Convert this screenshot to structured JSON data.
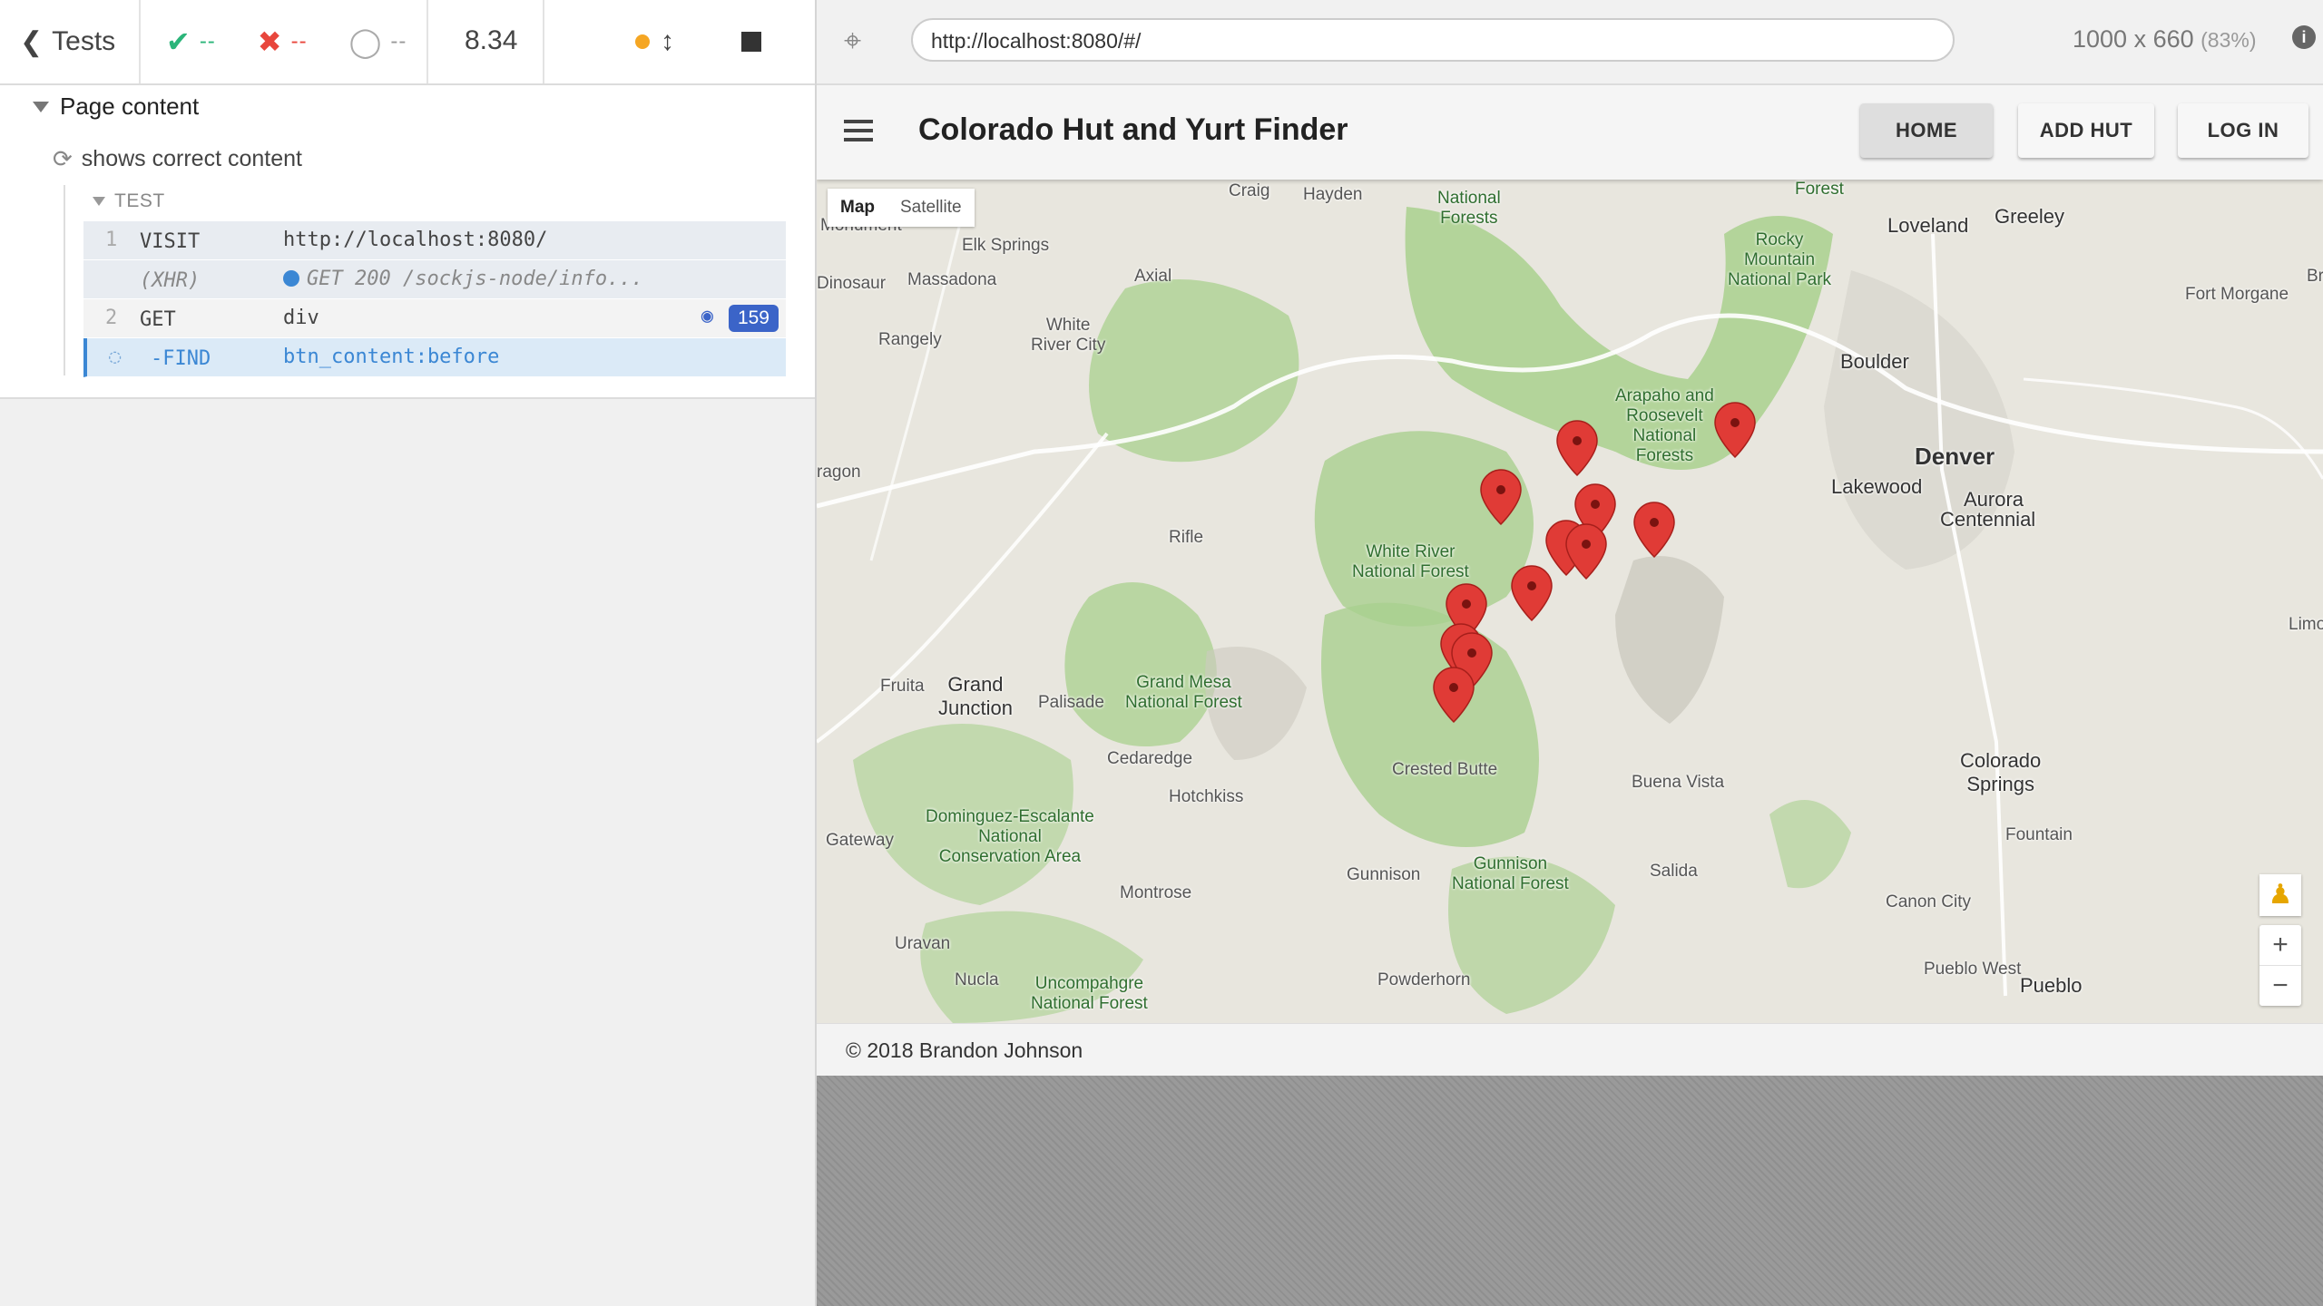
{
  "reporter": {
    "back_label": "Tests",
    "passed": "--",
    "failed": "--",
    "pending": "--",
    "duration": "8.34",
    "suite_title": "Page content",
    "test_title": "shows correct content",
    "test_section": "TEST",
    "commands": [
      {
        "num": "1",
        "name": "VISIT",
        "message": "http://localhost:8080/"
      },
      {
        "num": "",
        "name": "(XHR)",
        "message": "GET 200 /sockjs-node/info..."
      },
      {
        "num": "2",
        "name": "GET",
        "message": "div",
        "count": "159"
      },
      {
        "num": "",
        "name": "-FIND",
        "message": "btn_content:before"
      }
    ]
  },
  "aut": {
    "url": "http://localhost:8080/#/",
    "viewport": "1000 x 660",
    "scale": "(83%)"
  },
  "app": {
    "title": "Colorado Hut and Yurt Finder",
    "nav": [
      "HOME",
      "ADD HUT",
      "LOG IN"
    ],
    "map_types": [
      "Map",
      "Satellite"
    ],
    "footer": "© 2018 Brandon Johnson",
    "map_labels": {
      "monument": "Monument",
      "elk_springs": "Elk Springs",
      "dinosaur": "Dinosaur",
      "massadona": "Massadona",
      "rangely": "Rangely",
      "white_river_city": "White\nRiver City",
      "axial": "Axial",
      "craig": "Craig",
      "hayden": "Hayden",
      "loveland": "Loveland",
      "greeley": "Greeley",
      "fort_morgan": "Fort Morgane",
      "boulder": "Boulder",
      "denver": "Denver",
      "lakewood": "Lakewood",
      "aurora": "Aurora",
      "centennial": "Centennial",
      "grand_junction": "Grand\nJunction",
      "fruita": "Fruita",
      "palisade": "Palisade",
      "cedaredge": "Cedaredge",
      "hotchkiss": "Hotchkiss",
      "montrose": "Montrose",
      "gunnison": "Gunnison",
      "crested_butte": "Crested Butte",
      "buena_vista": "Buena Vista",
      "salida": "Salida",
      "canon_city": "Canon City",
      "colorado_springs": "Colorado\nSprings",
      "fountain": "Fountain",
      "pueblo_west": "Pueblo West",
      "pueblo": "Pueblo",
      "uravan": "Uravan",
      "nucla": "Nucla",
      "powderhorn": "Powderhorn",
      "limo": "Limo",
      "rifle": "Rifle",
      "gateway": "Gateway",
      "ragon": "ragon",
      "br": "Br",
      "rocky_mountain_np": "Rocky\nMountain\nNational Park",
      "national_forests_top": "National\nForests",
      "arapaho": "Arapaho and\nRoosevelt\nNational\nForests",
      "white_river_nf": "White River\nNational Forest",
      "grand_mesa_nf": "Grand Mesa\nNational Forest",
      "gunnison_nf": "Gunnison\nNational Forest",
      "dominguez": "Dominguez-Escalante\nNational\nConservation Area",
      "uncompahgre": "Uncompahgre\nNational Forest",
      "forest_top": "Forest"
    }
  },
  "colors": {
    "accent": "#3b87d4",
    "badge": "#3b64c8",
    "pass": "#2bb57a",
    "fail": "#e8463c",
    "marker": "#e03b36",
    "forest": "#a9d08e",
    "land": "#e8e6de"
  },
  "icons": [
    "chevron-left-icon",
    "check-icon",
    "x-icon",
    "circle-pending-icon",
    "orange-dot-icon",
    "updown-arrow-icon",
    "stop-icon",
    "crosshair-icon",
    "info-icon",
    "refresh-icon",
    "eye-icon",
    "hamburger-icon",
    "map-marker-icon",
    "pegman-icon",
    "zoom-in-icon",
    "zoom-out-icon"
  ]
}
